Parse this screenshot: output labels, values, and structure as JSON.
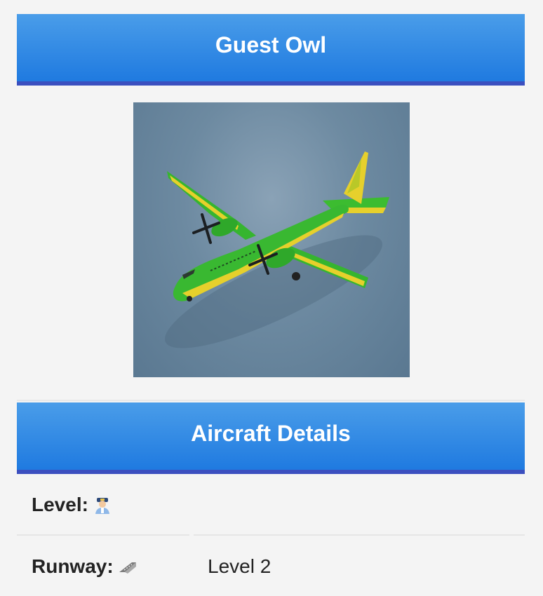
{
  "header": {
    "title": "Guest Owl"
  },
  "aircraft": {
    "image_icon": "airplane-image",
    "colors": {
      "body": "#33b52f",
      "accent": "#e9d12c",
      "background": "#6d8aa1"
    }
  },
  "details": {
    "title": "Aircraft Details",
    "level": {
      "label": "Level:",
      "icon": "pilot-icon",
      "value": ""
    },
    "runway": {
      "label": "Runway:",
      "icon": "runway-icon",
      "value": "Level 2"
    }
  },
  "colors": {
    "header_bg": "#2f86e5",
    "header_border": "#3b4fbf",
    "page_bg": "#f4f4f4"
  }
}
